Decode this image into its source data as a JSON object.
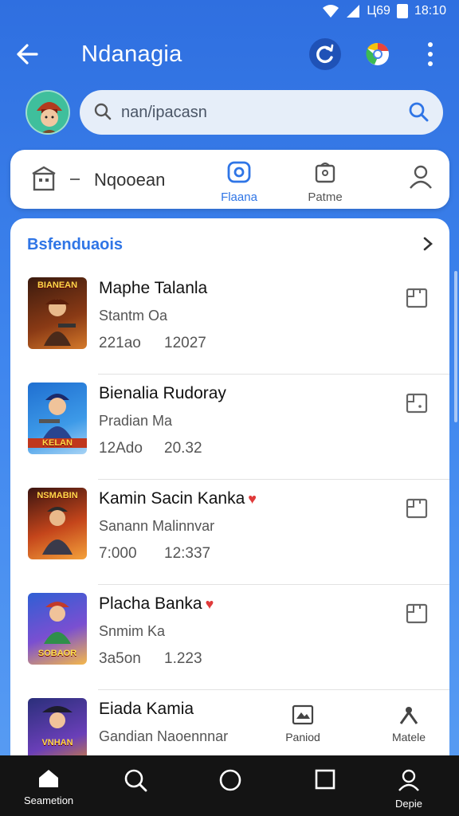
{
  "status": {
    "battery": "Ц69",
    "time": "18:10"
  },
  "appbar": {
    "title": "Ndanagia"
  },
  "search": {
    "placeholder": "nan/ipacasn"
  },
  "store": {
    "name": "Nqooean"
  },
  "tabs": [
    {
      "label": "Flaana",
      "active": true
    },
    {
      "label": "Patme",
      "active": false
    }
  ],
  "section": {
    "title": "Bsfenduaois"
  },
  "apps": [
    {
      "name": "Maphe Talanla",
      "subtitle": "Stantm Oa",
      "meta1": "221ao",
      "meta2": "12027",
      "thumb_caption": "BIANEAN",
      "heart": false
    },
    {
      "name": "Bienalia Rudoray",
      "subtitle": "Pradian Ma",
      "meta1": "12Ado",
      "meta2": "20.32",
      "thumb_caption": "KELAN",
      "heart": false
    },
    {
      "name": "Kamin Sacin Kanka",
      "subtitle": "Sanann Malinnvar",
      "meta1": "7:000",
      "meta2": "12:337",
      "thumb_caption": "NSMABIN",
      "heart": true
    },
    {
      "name": "Placha Banka",
      "subtitle": "Snmim Ka",
      "meta1": "3a5on",
      "meta2": "1.223",
      "thumb_caption": "SOBAOR",
      "heart": true
    },
    {
      "name": "Eiada Kamia",
      "subtitle": "Gandian Naoennnar",
      "meta1": "",
      "meta2": "",
      "thumb_caption": "VNHAN",
      "heart": false
    }
  ],
  "floating_tabs": [
    {
      "label": "Paniod"
    },
    {
      "label": "Matele"
    }
  ],
  "bottom_nav": [
    {
      "label": "Seametion"
    },
    {
      "label": ""
    },
    {
      "label": ""
    },
    {
      "label": ""
    },
    {
      "label": "Depie"
    }
  ],
  "colors": {
    "accent": "#2f75e6",
    "background": "#3f86ee",
    "nav": "#141414"
  }
}
